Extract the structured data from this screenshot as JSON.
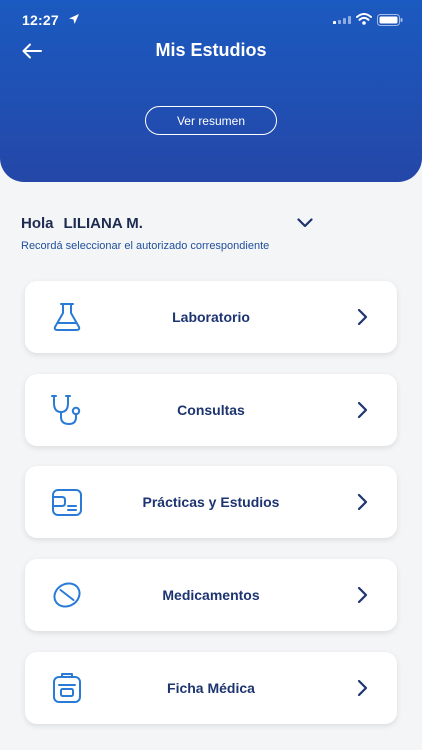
{
  "status_bar": {
    "time": "12:27"
  },
  "header": {
    "title": "Mis Estudios",
    "summary_button": "Ver resumen"
  },
  "user": {
    "greeting": "Hola",
    "name": "LILIANA M.",
    "hint": "Recordá seleccionar el autorizado correspondiente"
  },
  "menu": [
    {
      "label": "Laboratorio",
      "icon": "flask-icon"
    },
    {
      "label": "Consultas",
      "icon": "stethoscope-icon"
    },
    {
      "label": "Prácticas y Estudios",
      "icon": "clipboard-icon"
    },
    {
      "label": "Medicamentos",
      "icon": "pill-icon"
    },
    {
      "label": "Ficha Médica",
      "icon": "medical-record-icon"
    }
  ],
  "colors": {
    "header_top": "#1b5ac0",
    "header_bottom": "#2447a8",
    "text_dark": "#1d3470",
    "accent": "#2a7bd6",
    "background": "#f4f5f7"
  }
}
